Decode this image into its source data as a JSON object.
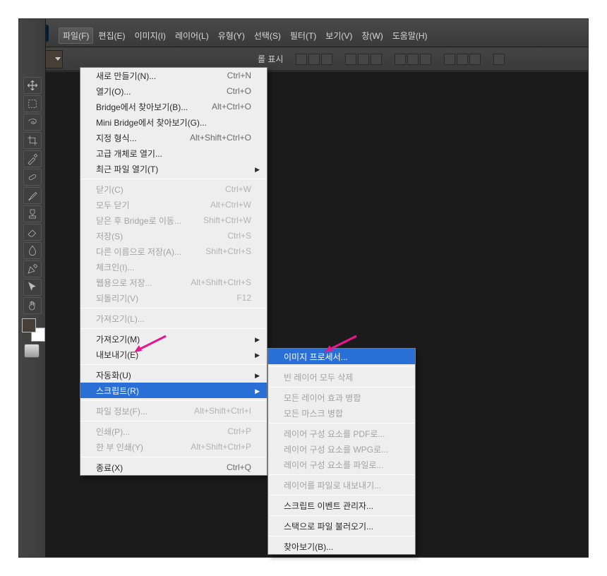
{
  "logo": "Ps",
  "menubar": [
    {
      "label": "파일(F)",
      "active": true
    },
    {
      "label": "편집(E)"
    },
    {
      "label": "이미지(I)"
    },
    {
      "label": "레이어(L)"
    },
    {
      "label": "유형(Y)"
    },
    {
      "label": "선택(S)"
    },
    {
      "label": "필터(T)"
    },
    {
      "label": "보기(V)"
    },
    {
      "label": "창(W)"
    },
    {
      "label": "도움말(H)"
    }
  ],
  "options_bar": {
    "label_fragment": "롤 표시"
  },
  "file_menu": [
    {
      "label": "새로 만들기(N)...",
      "sc": "Ctrl+N"
    },
    {
      "label": "열기(O)...",
      "sc": "Ctrl+O"
    },
    {
      "label": "Bridge에서 찾아보기(B)...",
      "sc": "Alt+Ctrl+O"
    },
    {
      "label": "Mini Bridge에서 찾아보기(G)..."
    },
    {
      "label": "지정 형식...",
      "sc": "Alt+Shift+Ctrl+O"
    },
    {
      "label": "고급 개체로 열기..."
    },
    {
      "label": "최근 파일 열기(T)",
      "sub": true
    },
    {
      "sep": true
    },
    {
      "label": "닫기(C)",
      "sc": "Ctrl+W",
      "disabled": true
    },
    {
      "label": "모두 닫기",
      "sc": "Alt+Ctrl+W",
      "disabled": true
    },
    {
      "label": "닫은 후 Bridge로 이동...",
      "sc": "Shift+Ctrl+W",
      "disabled": true
    },
    {
      "label": "저장(S)",
      "sc": "Ctrl+S",
      "disabled": true
    },
    {
      "label": "다른 이름으로 저장(A)...",
      "sc": "Shift+Ctrl+S",
      "disabled": true
    },
    {
      "label": "체크인(I)...",
      "disabled": true
    },
    {
      "label": "웹용으로 저장...",
      "sc": "Alt+Shift+Ctrl+S",
      "disabled": true
    },
    {
      "label": "되돌리기(V)",
      "sc": "F12",
      "disabled": true
    },
    {
      "sep": true
    },
    {
      "label": "가져오기(L)...",
      "disabled": true
    },
    {
      "sep": true
    },
    {
      "label": "가져오기(M)",
      "sub": true
    },
    {
      "label": "내보내기(E)",
      "sub": true
    },
    {
      "sep": true
    },
    {
      "label": "자동화(U)",
      "sub": true
    },
    {
      "label": "스크립트(R)",
      "sub": true,
      "highlight": true
    },
    {
      "sep": true
    },
    {
      "label": "파일 정보(F)...",
      "sc": "Alt+Shift+Ctrl+I",
      "disabled": true
    },
    {
      "sep": true
    },
    {
      "label": "인쇄(P)...",
      "sc": "Ctrl+P",
      "disabled": true
    },
    {
      "label": "한 부 인쇄(Y)",
      "sc": "Alt+Shift+Ctrl+P",
      "disabled": true
    },
    {
      "sep": true
    },
    {
      "label": "종료(X)",
      "sc": "Ctrl+Q"
    }
  ],
  "script_submenu": [
    {
      "label": "이미지 프로세서...",
      "highlight": true
    },
    {
      "sep": true
    },
    {
      "label": "빈 레이어 모두 삭제",
      "disabled": true
    },
    {
      "sep": true
    },
    {
      "label": "모든 레이어 효과 병합",
      "disabled": true
    },
    {
      "label": "모든 마스크 병합",
      "disabled": true
    },
    {
      "sep": true
    },
    {
      "label": "레이어 구성 요소를 PDF로...",
      "disabled": true
    },
    {
      "label": "레이어 구성 요소를 WPG로...",
      "disabled": true
    },
    {
      "label": "레이어 구성 요소를 파일로...",
      "disabled": true
    },
    {
      "sep": true
    },
    {
      "label": "레이어를 파일로 내보내기...",
      "disabled": true
    },
    {
      "sep": true
    },
    {
      "label": "스크립트 이벤트 관리자..."
    },
    {
      "sep": true
    },
    {
      "label": "스택으로 파일 불러오기..."
    },
    {
      "sep": true
    },
    {
      "label": "찾아보기(B)..."
    }
  ],
  "tools": [
    "move",
    "marquee",
    "lasso",
    "crop",
    "eyedropper",
    "healing",
    "brush",
    "stamp",
    "eraser",
    "blur",
    "pen",
    "direct",
    "hand"
  ]
}
